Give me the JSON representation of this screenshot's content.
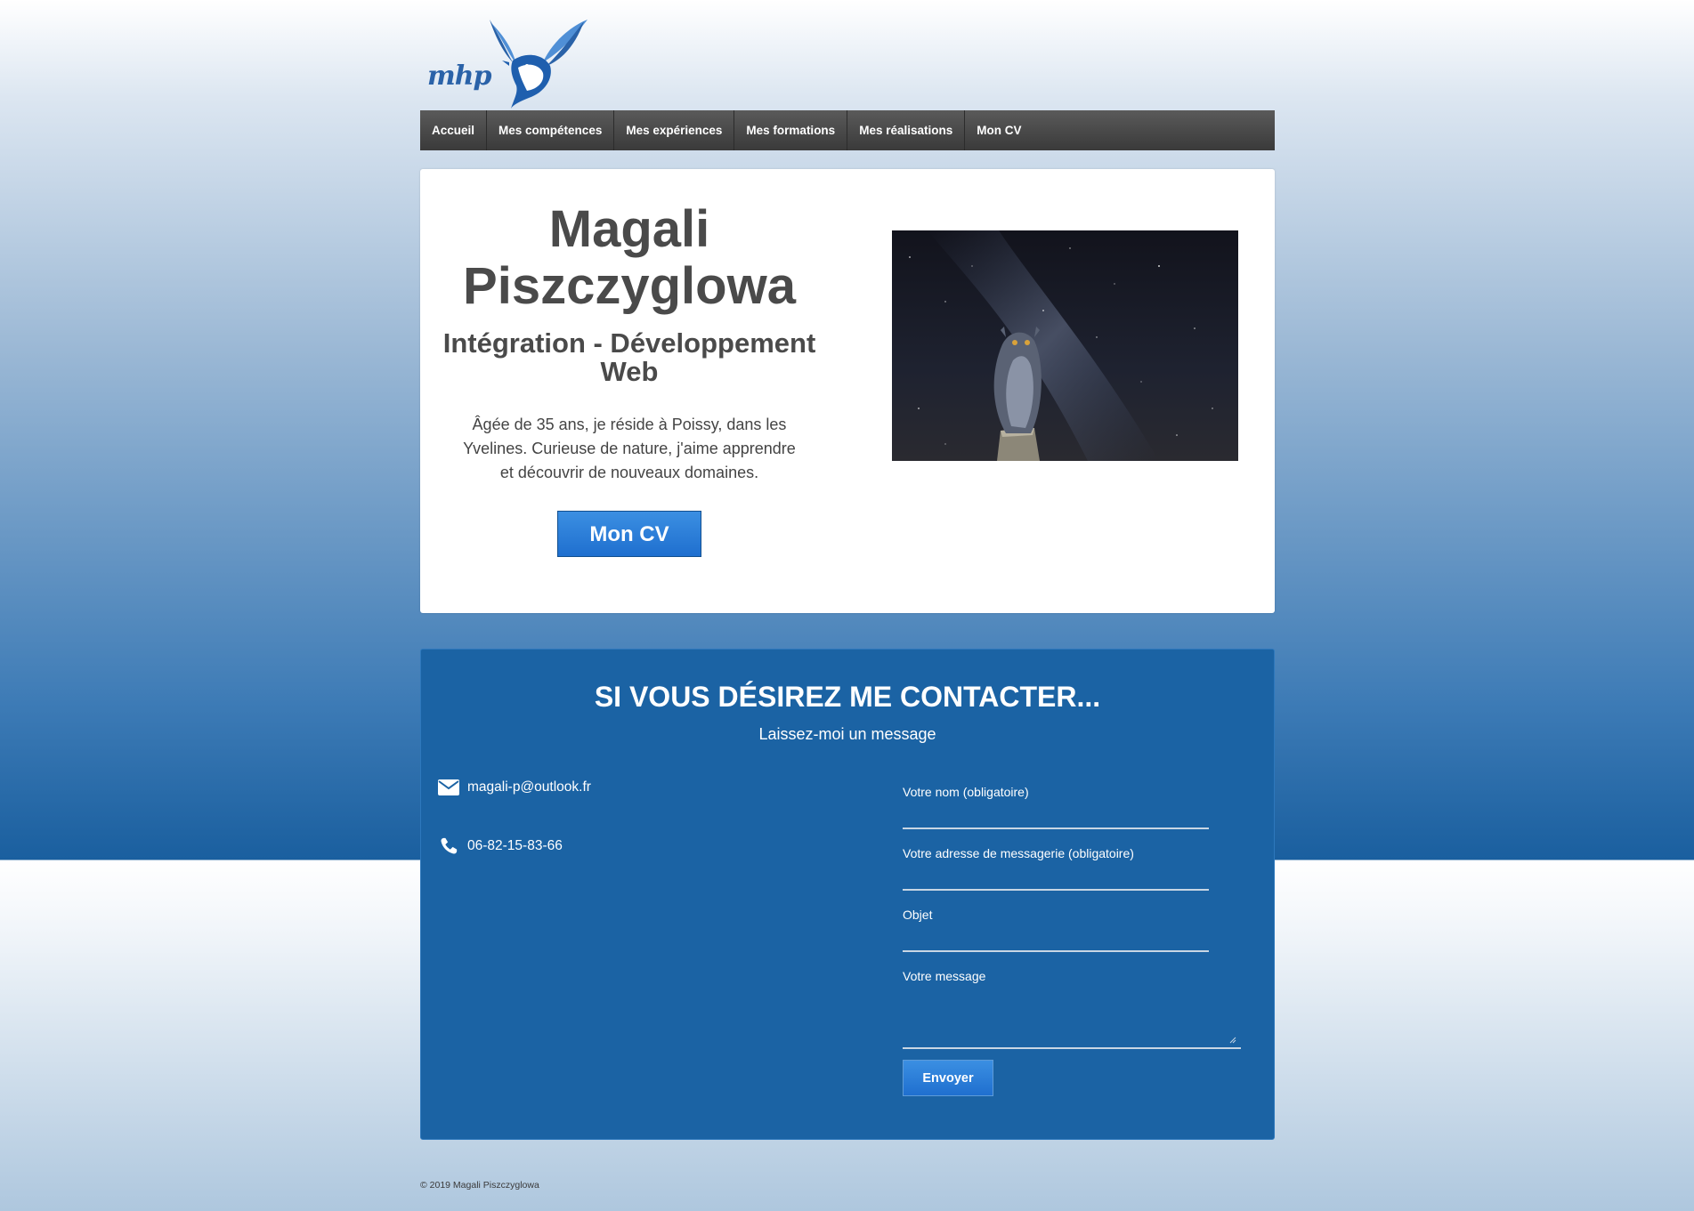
{
  "logo": {
    "text": "mhp"
  },
  "nav": {
    "items": [
      {
        "label": "Accueil"
      },
      {
        "label": "Mes compétences"
      },
      {
        "label": "Mes expériences"
      },
      {
        "label": "Mes formations"
      },
      {
        "label": "Mes réalisations"
      },
      {
        "label": "Mon CV"
      }
    ]
  },
  "hero": {
    "name_line1": "Magali",
    "name_line2": "Piszczyglowa",
    "subtitle_line1": "Intégration - Développement",
    "subtitle_line2": "Web",
    "desc_line1": "Âgée de 35 ans, je réside à Poissy, dans les",
    "desc_line2": "Yvelines. Curieuse de nature, j'aime apprendre",
    "desc_line3": "et découvrir de nouveaux domaines.",
    "cv_button": "Mon CV"
  },
  "contact": {
    "title": "SI VOUS DÉSIREZ ME CONTACTER...",
    "subtitle": "Laissez-moi un message",
    "email": "magali-p@outlook.fr",
    "phone": "06-82-15-83-66",
    "form": {
      "name_label": "Votre nom (obligatoire)",
      "email_label": "Votre adresse de messagerie (obligatoire)",
      "subject_label": "Objet",
      "message_label": "Votre message",
      "submit_label": "Envoyer"
    }
  },
  "colors": {
    "nav_bg": "#4a4a4a",
    "contact_bg": "#1b63a4",
    "button_blue": "#2a7ed9",
    "text_dark": "#4a4a4a"
  },
  "footer": {
    "copyright": "© 2019 Magali Piszczyglowa"
  }
}
